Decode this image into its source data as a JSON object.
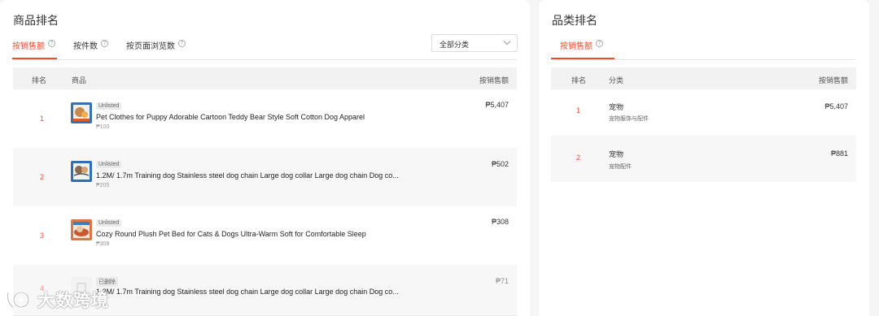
{
  "product_panel": {
    "title": "商品排名",
    "tabs": [
      {
        "label": "按销售额",
        "active": true
      },
      {
        "label": "按件数",
        "active": false
      },
      {
        "label": "按页面浏览数",
        "active": false
      }
    ],
    "category_select": {
      "value": "全部分类"
    },
    "table_headers": {
      "rank": "排名",
      "product": "商品",
      "sales": "按销售额"
    },
    "rows": [
      {
        "rank": "1",
        "badge": "Unlisted",
        "name": "Pet Clothes for Puppy Adorable Cartoon Teddy Bear Style Soft Cotton Dog Apparel",
        "price": "₱100",
        "sales": "₱5,407"
      },
      {
        "rank": "2",
        "badge": "Unlisted",
        "name": "1.2M/ 1.7m Training dog Stainless steel dog chain Large dog collar Large dog chain Dog co...",
        "price": "₱205",
        "sales": "₱502"
      },
      {
        "rank": "3",
        "badge": "Unlisted",
        "name": "Cozy Round Plush Pet Bed for Cats & Dogs Ultra-Warm Soft for Comfortable Sleep",
        "price": "₱308",
        "sales": "₱308"
      },
      {
        "rank": "4",
        "badge": "已删除",
        "name": "1.2M/ 1.7m Training dog Stainless steel dog chain Large dog collar Large dog chain Dog co...",
        "price": "",
        "sales": "₱71"
      }
    ]
  },
  "category_panel": {
    "title": "品类排名",
    "tabs": [
      {
        "label": "按销售额",
        "active": true
      }
    ],
    "table_headers": {
      "rank": "排名",
      "category": "分类",
      "sales": "按销售额"
    },
    "rows": [
      {
        "rank": "1",
        "name": "宠物",
        "sub": "宠物服饰与配件",
        "sales": "₱5,407"
      },
      {
        "rank": "2",
        "name": "宠物",
        "sub": "宠物配件",
        "sales": "₱881"
      }
    ]
  },
  "watermark": {
    "text": "大数跨境"
  },
  "colors": {
    "accent": "#ee4d2d",
    "background": "#f5f5f5",
    "panel": "#ffffff"
  },
  "icons": {
    "help": "question-circle-icon",
    "dropdown": "chevron-down-icon"
  }
}
